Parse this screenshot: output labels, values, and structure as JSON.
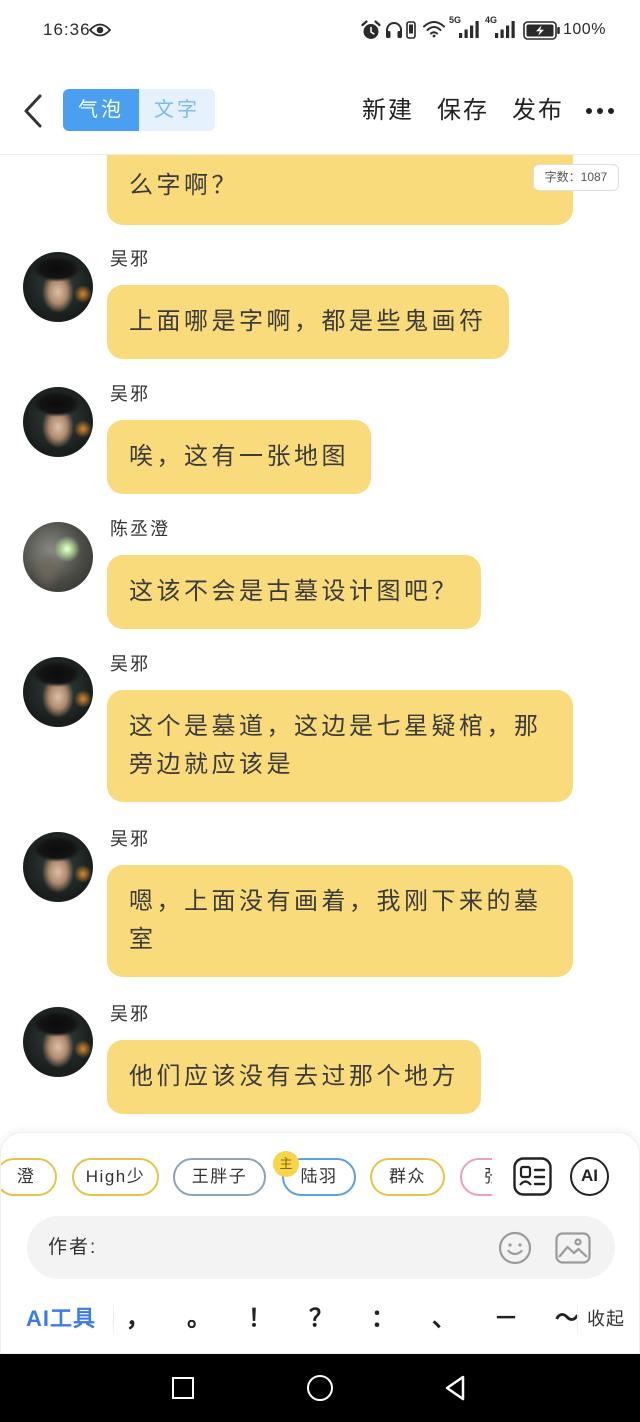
{
  "status_bar": {
    "time": "16:36",
    "sim1_network": "5G",
    "sim2_network": "4G",
    "battery": "100%"
  },
  "header": {
    "tabs": [
      {
        "label": "气泡",
        "active": true
      },
      {
        "label": "文字",
        "active": false
      }
    ],
    "new_label": "新建",
    "save_label": "保存",
    "publish_label": "发布"
  },
  "word_count": "字数：1087",
  "messages": [
    {
      "text": "么字啊？"
    },
    {
      "speaker": "吴邪",
      "text": "上面哪是字啊，都是些鬼画符"
    },
    {
      "speaker": "吴邪",
      "text": "唉，这有一张地图"
    },
    {
      "speaker": "陈丞澄",
      "text": "这该不会是古墓设计图吧？"
    },
    {
      "speaker": "吴邪",
      "text": "这个是墓道，这边是七星疑棺，那旁边就应该是"
    },
    {
      "speaker": "吴邪",
      "text": "嗯，上面没有画着，我刚下来的墓室"
    },
    {
      "speaker": "吴邪",
      "text": "他们应该没有去过那个地方"
    }
  ],
  "characters": [
    {
      "name": "澄",
      "color": "#e8c24a"
    },
    {
      "name": "High少",
      "color": "#e8c24a"
    },
    {
      "name": "王胖子",
      "color": "#8fa3b8"
    },
    {
      "name": "陆羽",
      "color": "#5aa0e6",
      "badge": "主"
    },
    {
      "name": "群众",
      "color": "#e8c24a"
    },
    {
      "name": "张",
      "color": "#f0a0b4"
    }
  ],
  "ai_button": "AI",
  "composer": {
    "author_label": "作者:"
  },
  "toolbar": {
    "ai_tools": "AI工具",
    "punctuation": [
      "，",
      "。",
      "！",
      "？",
      "：",
      "、",
      "－",
      "～"
    ],
    "collapse": "收起"
  },
  "colors": {
    "bubble": "#f9db7c",
    "accent": "#4a9ff0",
    "ai_tools": "#3b7be8"
  },
  "icons": [
    "eye-icon",
    "alarm-icon",
    "headphones-icon",
    "phone-icon",
    "wifi-icon",
    "signal-icon",
    "battery-icon",
    "chevron-left-icon",
    "more-icon",
    "contact-card-icon",
    "emoji-icon",
    "image-icon",
    "square-icon",
    "circle-icon",
    "triangle-back-icon"
  ]
}
